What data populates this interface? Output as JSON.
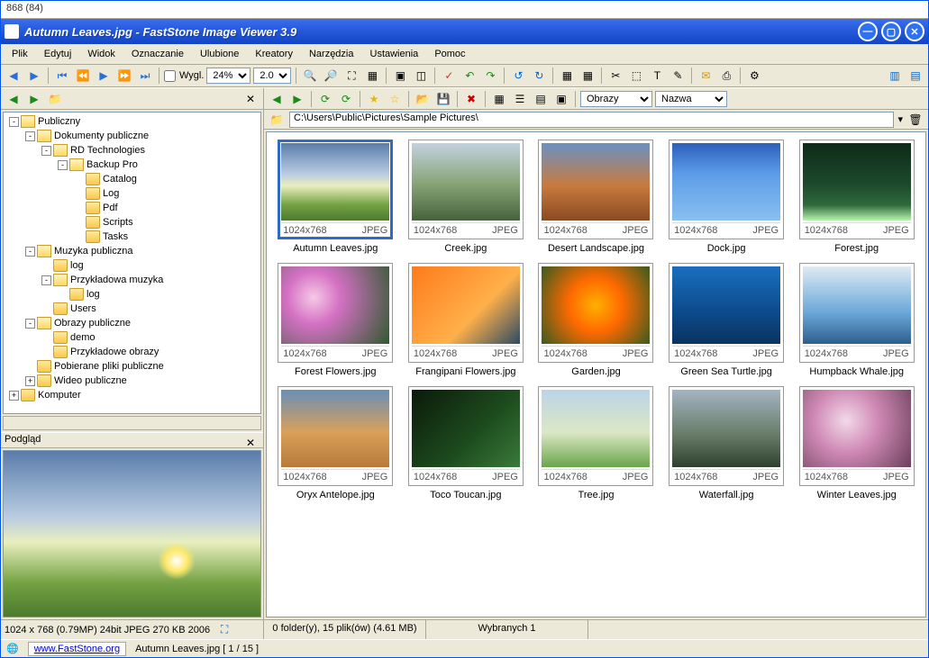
{
  "topline": "868 (84)",
  "title": "Autumn Leaves.jpg  -  FastStone Image Viewer 3.9",
  "menu": [
    "Plik",
    "Edytuj",
    "Widok",
    "Oznaczanie",
    "Ulubione",
    "Kreatory",
    "Narzędzia",
    "Ustawienia",
    "Pomoc"
  ],
  "toolbar": {
    "wygl_label": "Wygl.",
    "zoom": "24%",
    "zoom2": "2.0"
  },
  "rtoolbar": {
    "filter_label": "Obrazy",
    "sort_label": "Nazwa"
  },
  "path": "C:\\Users\\Public\\Pictures\\Sample Pictures\\",
  "tree": [
    {
      "depth": 0,
      "exp": "-",
      "icon": "open",
      "label": "Publiczny"
    },
    {
      "depth": 1,
      "exp": "-",
      "icon": "open",
      "label": "Dokumenty publiczne"
    },
    {
      "depth": 2,
      "exp": "-",
      "icon": "open",
      "label": "RD Technologies"
    },
    {
      "depth": 3,
      "exp": "-",
      "icon": "open",
      "label": "Backup Pro"
    },
    {
      "depth": 4,
      "exp": "",
      "icon": "folder",
      "label": "Catalog"
    },
    {
      "depth": 4,
      "exp": "",
      "icon": "folder",
      "label": "Log"
    },
    {
      "depth": 4,
      "exp": "",
      "icon": "folder",
      "label": "Pdf"
    },
    {
      "depth": 4,
      "exp": "",
      "icon": "folder",
      "label": "Scripts"
    },
    {
      "depth": 4,
      "exp": "",
      "icon": "folder",
      "label": "Tasks"
    },
    {
      "depth": 1,
      "exp": "-",
      "icon": "open",
      "label": "Muzyka publiczna"
    },
    {
      "depth": 2,
      "exp": "",
      "icon": "folder",
      "label": "log"
    },
    {
      "depth": 2,
      "exp": "-",
      "icon": "open",
      "label": "Przykładowa muzyka"
    },
    {
      "depth": 3,
      "exp": "",
      "icon": "folder",
      "label": "log"
    },
    {
      "depth": 2,
      "exp": "",
      "icon": "folder",
      "label": "Users"
    },
    {
      "depth": 1,
      "exp": "-",
      "icon": "open",
      "label": "Obrazy publiczne"
    },
    {
      "depth": 2,
      "exp": "",
      "icon": "folder",
      "label": "demo"
    },
    {
      "depth": 2,
      "exp": "",
      "icon": "folder",
      "label": "Przykładowe obrazy"
    },
    {
      "depth": 1,
      "exp": "",
      "icon": "folder",
      "label": "Pobierane pliki publiczne"
    },
    {
      "depth": 1,
      "exp": "+",
      "icon": "folder",
      "label": "Wideo publiczne"
    },
    {
      "depth": 0,
      "exp": "+",
      "icon": "folder",
      "label": "Komputer"
    }
  ],
  "preview_label": "Podgląd",
  "thumbnails": [
    {
      "name": "Autumn Leaves.jpg",
      "dim": "1024x768",
      "fmt": "JPEG",
      "cls": "g-autumn",
      "sel": true
    },
    {
      "name": "Creek.jpg",
      "dim": "1024x768",
      "fmt": "JPEG",
      "cls": "g-creek"
    },
    {
      "name": "Desert Landscape.jpg",
      "dim": "1024x768",
      "fmt": "JPEG",
      "cls": "g-desert"
    },
    {
      "name": "Dock.jpg",
      "dim": "1024x768",
      "fmt": "JPEG",
      "cls": "g-dock"
    },
    {
      "name": "Forest.jpg",
      "dim": "1024x768",
      "fmt": "JPEG",
      "cls": "g-forest"
    },
    {
      "name": "Forest Flowers.jpg",
      "dim": "1024x768",
      "fmt": "JPEG",
      "cls": "g-fflowers"
    },
    {
      "name": "Frangipani Flowers.jpg",
      "dim": "1024x768",
      "fmt": "JPEG",
      "cls": "g-frangi"
    },
    {
      "name": "Garden.jpg",
      "dim": "1024x768",
      "fmt": "JPEG",
      "cls": "g-garden"
    },
    {
      "name": "Green Sea Turtle.jpg",
      "dim": "1024x768",
      "fmt": "JPEG",
      "cls": "g-turtle"
    },
    {
      "name": "Humpback Whale.jpg",
      "dim": "1024x768",
      "fmt": "JPEG",
      "cls": "g-whale"
    },
    {
      "name": "Oryx Antelope.jpg",
      "dim": "1024x768",
      "fmt": "JPEG",
      "cls": "g-oryx"
    },
    {
      "name": "Toco Toucan.jpg",
      "dim": "1024x768",
      "fmt": "JPEG",
      "cls": "g-toucan"
    },
    {
      "name": "Tree.jpg",
      "dim": "1024x768",
      "fmt": "JPEG",
      "cls": "g-tree"
    },
    {
      "name": "Waterfall.jpg",
      "dim": "1024x768",
      "fmt": "JPEG",
      "cls": "g-wfall"
    },
    {
      "name": "Winter Leaves.jpg",
      "dim": "1024x768",
      "fmt": "JPEG",
      "cls": "g-wleaves"
    }
  ],
  "status": {
    "left": "1024 x 768 (0.79MP)   24bit JPEG   270 KB   2006",
    "folder": "0 folder(y), 15 plik(ów) (4.61 MB)",
    "selected": "Wybranych 1"
  },
  "footer": {
    "link": "www.FastStone.org",
    "info": "Autumn Leaves.jpg [ 1 / 15 ]"
  }
}
